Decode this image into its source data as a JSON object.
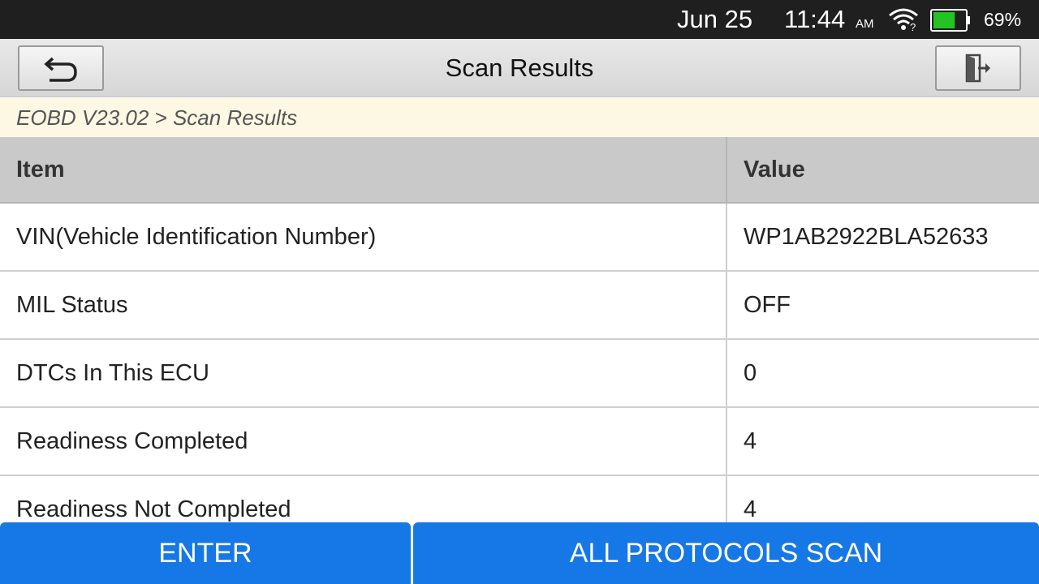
{
  "status_bar": {
    "date": "Jun 25",
    "time": "11:44",
    "ampm": "AM",
    "battery_percent": "69%",
    "battery_level": 0.69,
    "icons": [
      "wifi-icon",
      "battery-icon"
    ],
    "colors": {
      "background": "#1f1f1f",
      "battery_fill": "#22c322"
    }
  },
  "title_bar": {
    "title": "Scan Results",
    "back_icon": "back-arrow-icon",
    "exit_icon": "exit-door-icon"
  },
  "breadcrumb": "EOBD V23.02 > Scan Results",
  "table": {
    "headers": {
      "item": "Item",
      "value": "Value"
    },
    "rows": [
      {
        "item": "VIN(Vehicle Identification Number)",
        "value": "WP1AB2922BLA52633"
      },
      {
        "item": "MIL Status",
        "value": "OFF"
      },
      {
        "item": "DTCs In This ECU",
        "value": "0"
      },
      {
        "item": "Readiness Completed",
        "value": "4"
      },
      {
        "item": "Readiness Not Completed",
        "value": "4"
      }
    ]
  },
  "buttons": {
    "enter": "ENTER",
    "all_protocols_scan": "ALL PROTOCOLS SCAN",
    "color": "#1677e6"
  }
}
